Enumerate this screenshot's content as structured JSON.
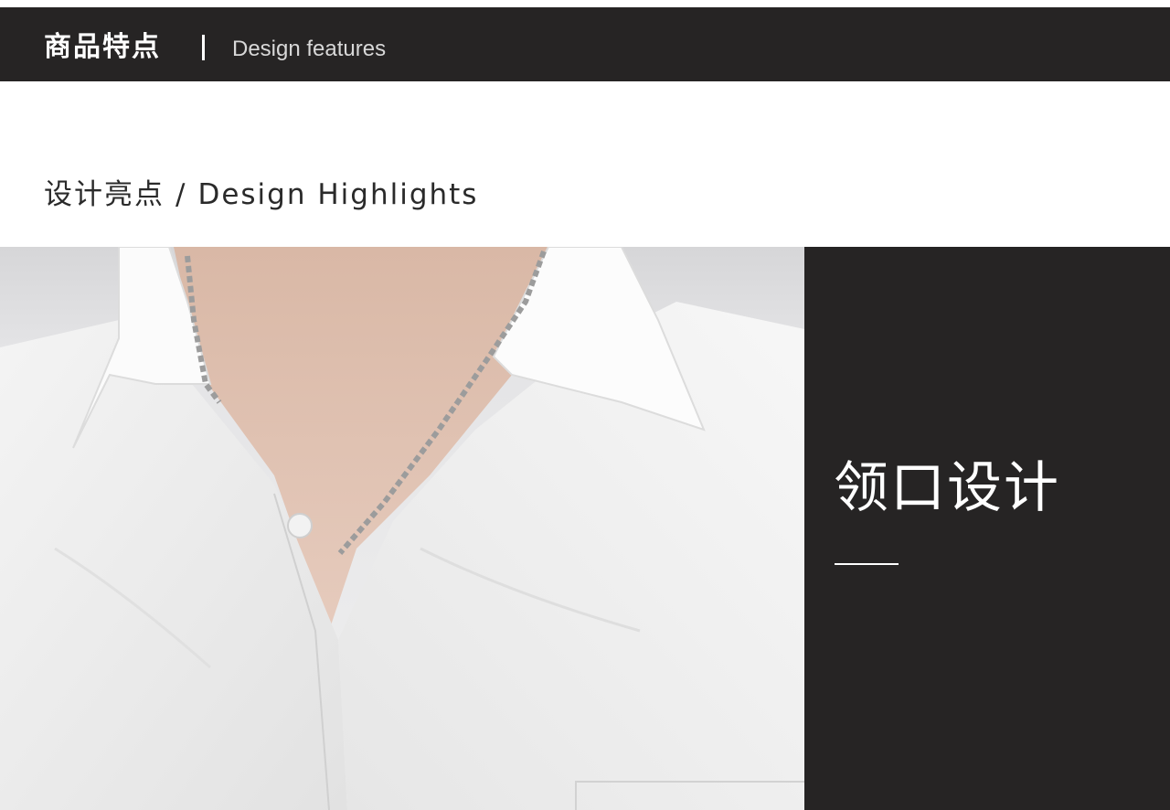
{
  "header": {
    "title_cn": "商品特点",
    "title_en": "Design features"
  },
  "section": {
    "heading_cn": "设计亮点",
    "separator": "/",
    "heading_en": "Design Highlights"
  },
  "feature": {
    "title": "领口设计",
    "photo_subject": "white shirt collar with silver chain necklace"
  },
  "colors": {
    "header_bg": "#262424",
    "caption_bg": "#262424",
    "text_dark": "#2a2a2a",
    "text_light": "#ffffff"
  }
}
